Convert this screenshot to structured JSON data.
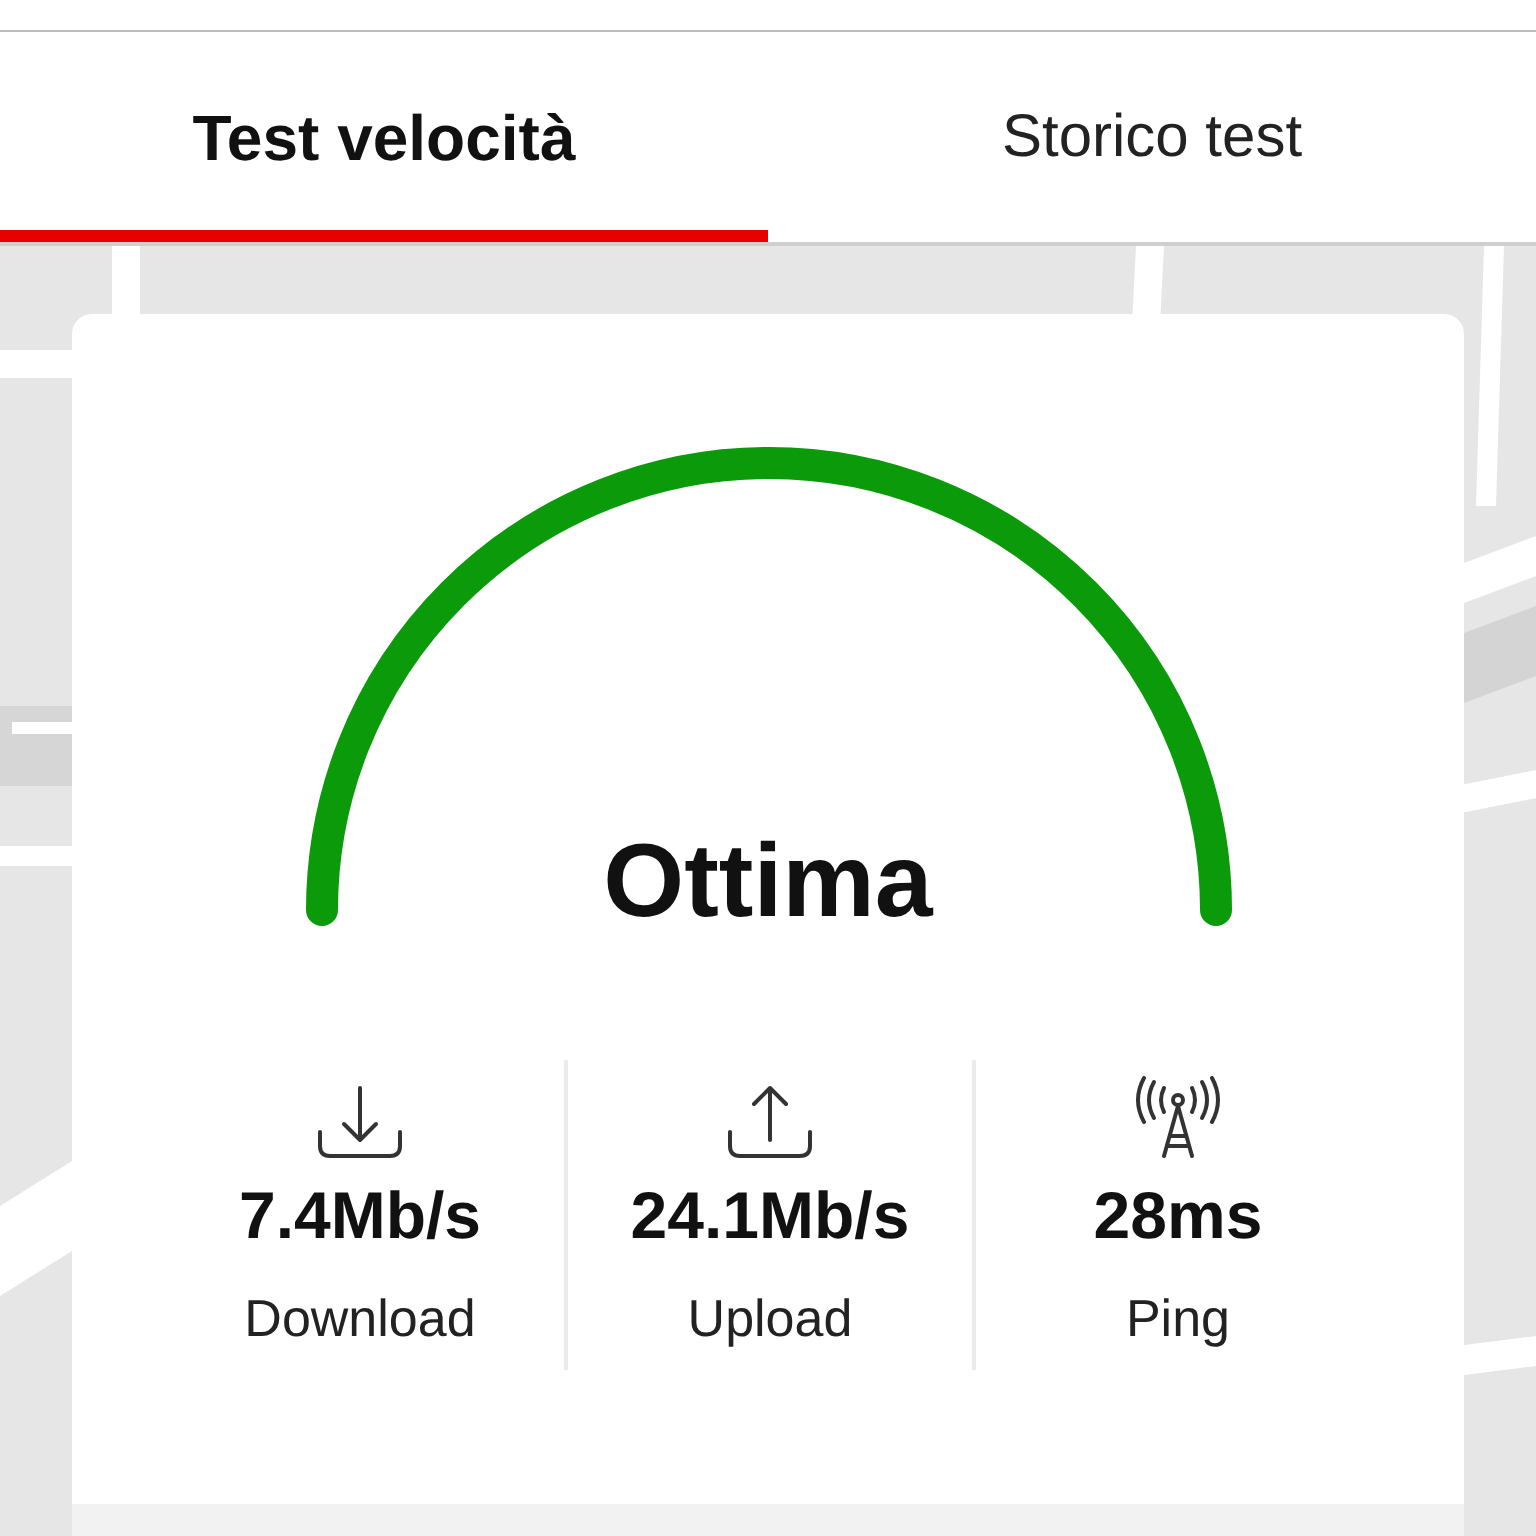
{
  "tabs": [
    {
      "label": "Test velocità",
      "selected": true
    },
    {
      "label": "Storico test",
      "selected": false
    }
  ],
  "gauge": {
    "rating": "Ottima"
  },
  "stats": [
    {
      "kind": "download",
      "value": "7.4Mb/s",
      "label": "Download"
    },
    {
      "kind": "upload",
      "value": "24.1Mb/s",
      "label": "Upload"
    },
    {
      "kind": "ping",
      "value": "28ms",
      "label": "Ping"
    }
  ]
}
